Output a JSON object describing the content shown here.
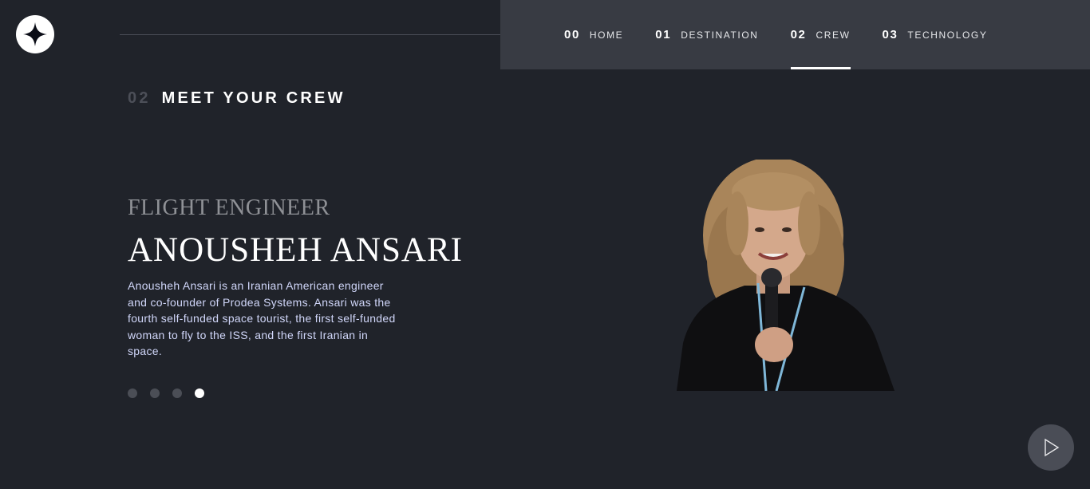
{
  "logo": {
    "icon": "star-icon"
  },
  "nav": {
    "items": [
      {
        "num": "00",
        "label": "HOME",
        "active": false
      },
      {
        "num": "01",
        "label": "DESTINATION",
        "active": false
      },
      {
        "num": "02",
        "label": "CREW",
        "active": true
      },
      {
        "num": "03",
        "label": "TECHNOLOGY",
        "active": false
      }
    ]
  },
  "section": {
    "num": "02",
    "title": "MEET YOUR CREW"
  },
  "crew": {
    "role": "FLIGHT ENGINEER",
    "name": "ANOUSHEH ANSARI",
    "bio": "Anousheh Ansari is an Iranian American engineer and co-founder of Prodea Systems. Ansari was the fourth self-funded space tourist, the first self-funded woman to fly to the ISS, and the first Iranian in space."
  },
  "carousel": {
    "count": 4,
    "active_index": 3
  },
  "play_button": {
    "icon": "play-icon"
  },
  "colors": {
    "background": "#20232a",
    "nav_background": "#383b43",
    "text_muted": "#8f9196",
    "text_body": "#d0d6f9"
  }
}
